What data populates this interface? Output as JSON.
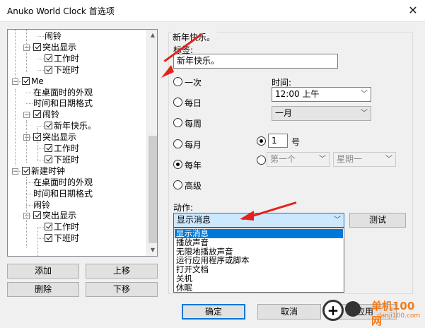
{
  "window": {
    "title": "Anuko World Clock 首选项",
    "close_glyph": "✕"
  },
  "tree": {
    "rows": [
      {
        "label": "闹铃",
        "checkbox": false
      },
      {
        "label": "突出显示",
        "checkbox": true
      },
      {
        "label": "工作时",
        "checkbox": true
      },
      {
        "label": "下班时",
        "checkbox": true
      },
      {
        "label": "Me",
        "checkbox": true
      },
      {
        "label": "在桌面时的外观",
        "checkbox": false
      },
      {
        "label": "时间和日期格式",
        "checkbox": false
      },
      {
        "label": "闹铃",
        "checkbox": true
      },
      {
        "label": "新年快乐。",
        "checkbox": true
      },
      {
        "label": "突出显示",
        "checkbox": true
      },
      {
        "label": "工作时",
        "checkbox": true
      },
      {
        "label": "下班时",
        "checkbox": true
      },
      {
        "label": "新建时钟",
        "checkbox": true
      },
      {
        "label": "在桌面时的外观",
        "checkbox": false
      },
      {
        "label": "时间和日期格式",
        "checkbox": false
      },
      {
        "label": "闹铃",
        "checkbox": false
      },
      {
        "label": "突出显示",
        "checkbox": true
      },
      {
        "label": "工作时",
        "checkbox": true
      },
      {
        "label": "下班时",
        "checkbox": true
      }
    ]
  },
  "left_buttons": {
    "add": "添加",
    "move_up": "上移",
    "delete": "删除",
    "move_down": "下移"
  },
  "panel": {
    "group_title": "新年快乐。",
    "label_caption": "标签:",
    "label_value": "新年快乐。",
    "repeat_options": [
      "一次",
      "每日",
      "每周",
      "每月",
      "每年",
      "高级"
    ],
    "time_caption": "时间:",
    "time_value": "12:00 上午",
    "month_value": "一月",
    "day_number": "1",
    "day_suffix": "号",
    "ordinal_value": "第一个",
    "weekday_value": "星期一",
    "action_caption": "动作:",
    "action_value": "显示消息",
    "test_button": "测试",
    "action_options": [
      "显示消息",
      "播放声音",
      "无限地播放声音",
      "运行应用程序或脚本",
      "打开文档",
      "关机",
      "休眠"
    ]
  },
  "bottom_buttons": {
    "ok": "确定",
    "cancel": "取消",
    "apply": "应用"
  },
  "watermark": {
    "text": "单机100网",
    "sub": "danji100.com",
    "glyph": "+"
  },
  "colors": {
    "accent": "#0078d7",
    "annotation_arrow": "#e3221b"
  }
}
